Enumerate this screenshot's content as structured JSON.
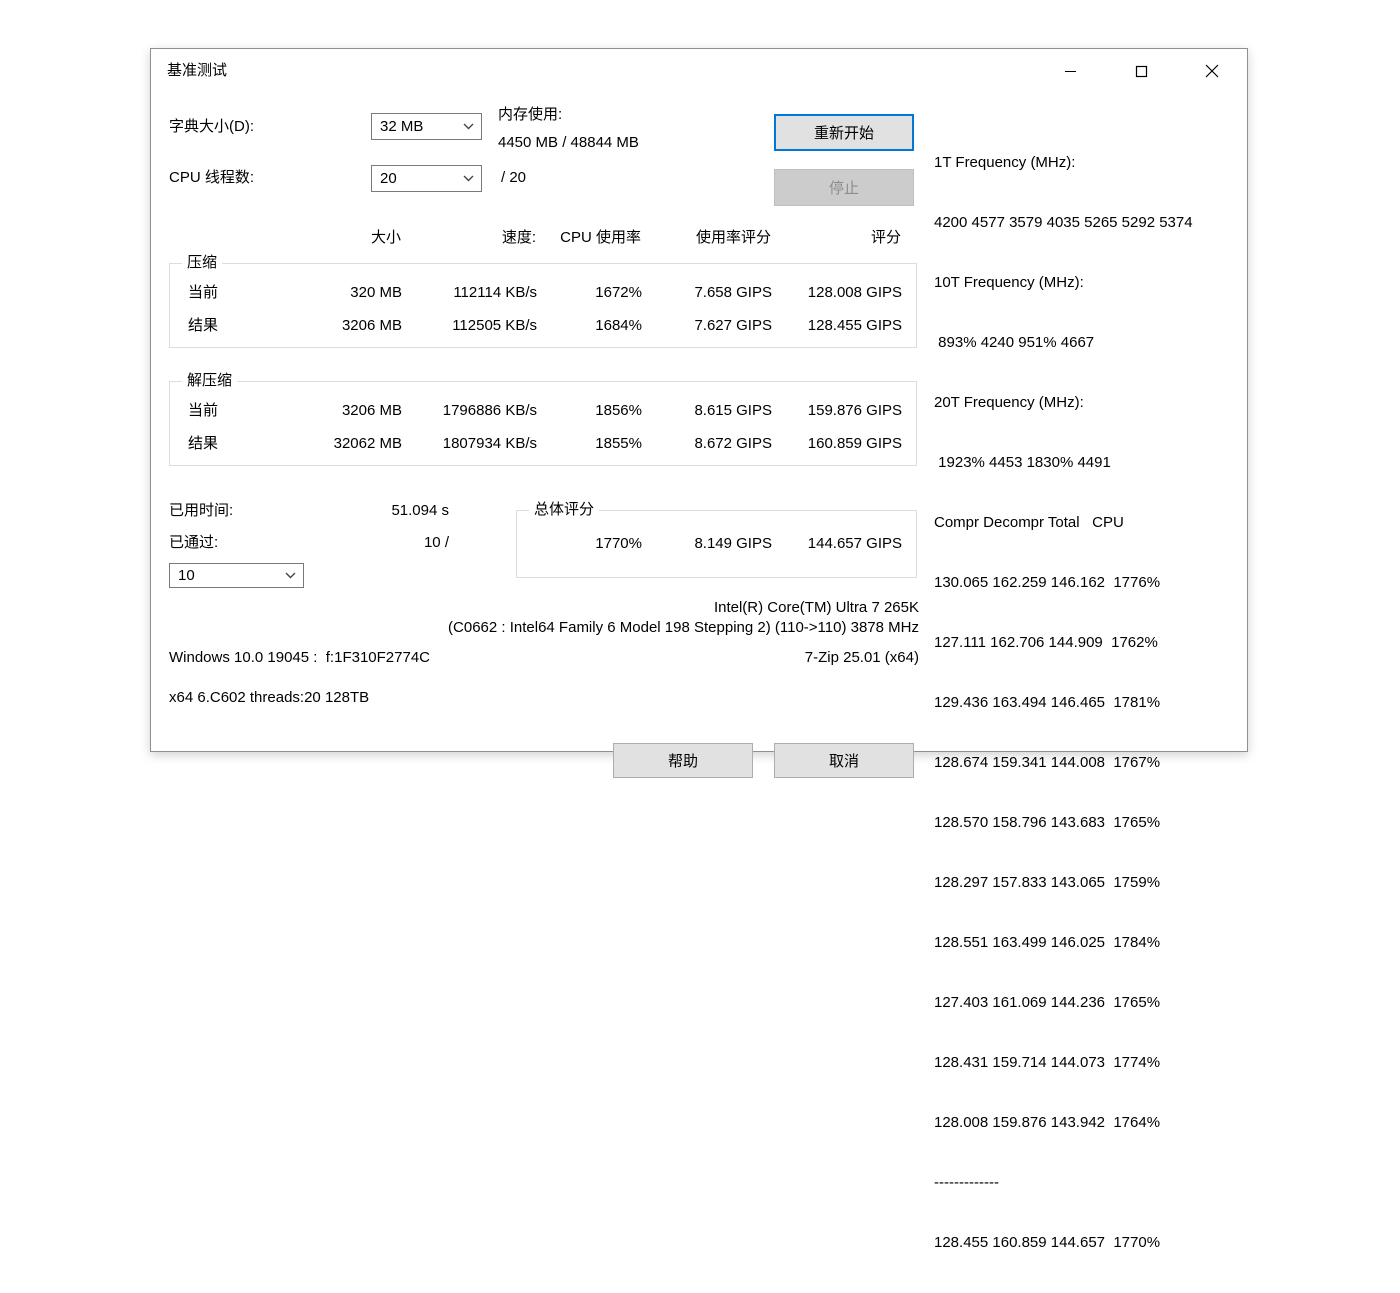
{
  "window": {
    "title": "基准测试"
  },
  "settings": {
    "dict_label": "字典大小(D):",
    "dict_value": "32 MB",
    "memory_label": "内存使用:",
    "memory_value": "4450 MB / 48844 MB",
    "threads_label": "CPU 线程数:",
    "threads_value": "20",
    "threads_suffix": "/ 20",
    "restart_button": "重新开始",
    "stop_button": "停止"
  },
  "table": {
    "headers": [
      "大小",
      "速度:",
      "CPU 使用率",
      "使用率评分",
      "评分"
    ],
    "compression": {
      "label": "压缩",
      "rows": [
        {
          "name": "当前",
          "size": "320 MB",
          "speed": "112114 KB/s",
          "cpu": "1672%",
          "usage_rating": "7.658 GIPS",
          "rating": "128.008 GIPS"
        },
        {
          "name": "结果",
          "size": "3206 MB",
          "speed": "112505 KB/s",
          "cpu": "1684%",
          "usage_rating": "7.627 GIPS",
          "rating": "128.455 GIPS"
        }
      ]
    },
    "decompression": {
      "label": "解压缩",
      "rows": [
        {
          "name": "当前",
          "size": "3206 MB",
          "speed": "1796886 KB/s",
          "cpu": "1856%",
          "usage_rating": "8.615 GIPS",
          "rating": "159.876 GIPS"
        },
        {
          "name": "结果",
          "size": "32062 MB",
          "speed": "1807934 KB/s",
          "cpu": "1855%",
          "usage_rating": "8.672 GIPS",
          "rating": "160.859 GIPS"
        }
      ]
    }
  },
  "status": {
    "elapsed_label": "已用时间:",
    "elapsed_value": "51.094 s",
    "passes_label": "已通过:",
    "passes_value": "10 /",
    "passes_select_value": "10"
  },
  "total": {
    "label": "总体评分",
    "cpu": "1770%",
    "usage_rating": "8.149 GIPS",
    "rating": "144.657 GIPS"
  },
  "system": {
    "cpu_name": "Intel(R) Core(TM) Ultra 7 265K",
    "cpu_details": "(C0662 : Intel64 Family 6 Model 198 Stepping 2) (110->110) 3878 MHz",
    "os_info": "Windows 10.0 19045 :  f:1F310F2774C",
    "app_version": "7-Zip 25.01 (x64)",
    "build_info": "x64 6.C602 threads:20 128TB"
  },
  "footer": {
    "help_button": "帮助",
    "cancel_button": "取消"
  },
  "log": {
    "lines": [
      "1T Frequency (MHz):",
      "4200 4577 3579 4035 5265 5292 5374",
      "10T Frequency (MHz):",
      " 893% 4240 951% 4667",
      "20T Frequency (MHz):",
      " 1923% 4453 1830% 4491",
      "Compr Decompr Total   CPU",
      "130.065 162.259 146.162  1776%",
      "127.111 162.706 144.909  1762%",
      "129.436 163.494 146.465  1781%",
      "128.674 159.341 144.008  1767%",
      "128.570 158.796 143.683  1765%",
      "128.297 157.833 143.065  1759%",
      "128.551 163.499 146.025  1784%",
      "127.403 161.069 144.236  1765%",
      "128.431 159.714 144.073  1774%",
      "128.008 159.876 143.942  1764%",
      "-------------",
      "128.455 160.859 144.657  1770%"
    ]
  }
}
